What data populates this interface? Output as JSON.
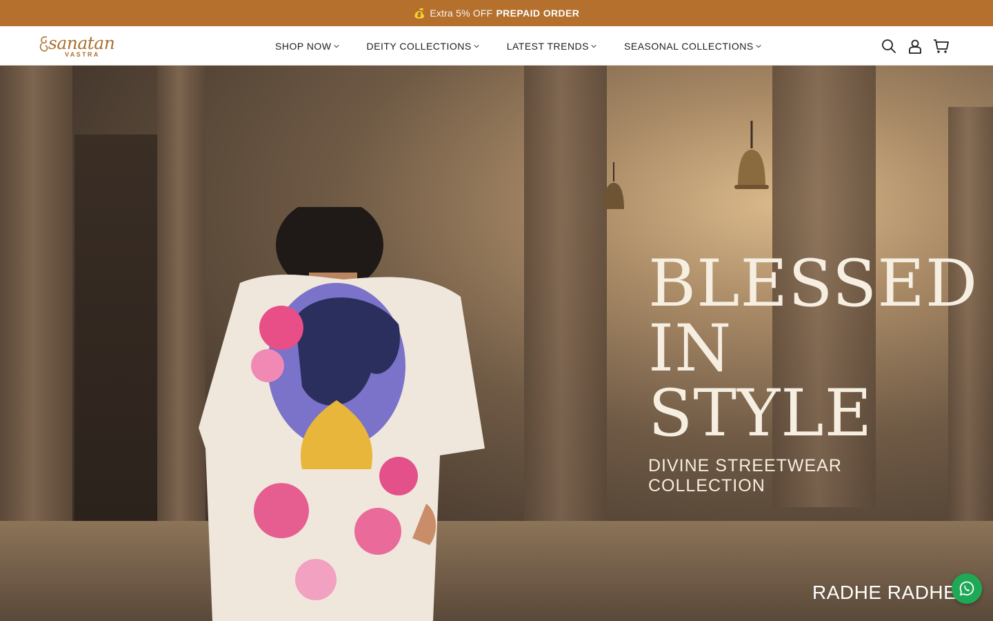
{
  "announcement": {
    "icon": "money-bag-icon",
    "text": "Extra 5% OFF",
    "highlight": "PREPAID ORDER"
  },
  "logo": {
    "word": "sanatan",
    "sub": "VASTRA"
  },
  "nav": {
    "items": [
      {
        "label": "SHOP NOW"
      },
      {
        "label": "DEITY COLLECTIONS"
      },
      {
        "label": "LATEST TRENDS"
      },
      {
        "label": "SEASONAL COLLECTIONS"
      }
    ]
  },
  "header_icons": [
    "search-icon",
    "account-icon",
    "cart-icon"
  ],
  "hero": {
    "line1": "BLESSED",
    "line2": "IN STYLE",
    "line3": "DIVINE STREETWEAR COLLECTION",
    "marquee": "RADHE RADHE -"
  },
  "colors": {
    "announcement_bg": "#b4702c",
    "brand": "#a9702f",
    "whatsapp": "#1fa855"
  }
}
